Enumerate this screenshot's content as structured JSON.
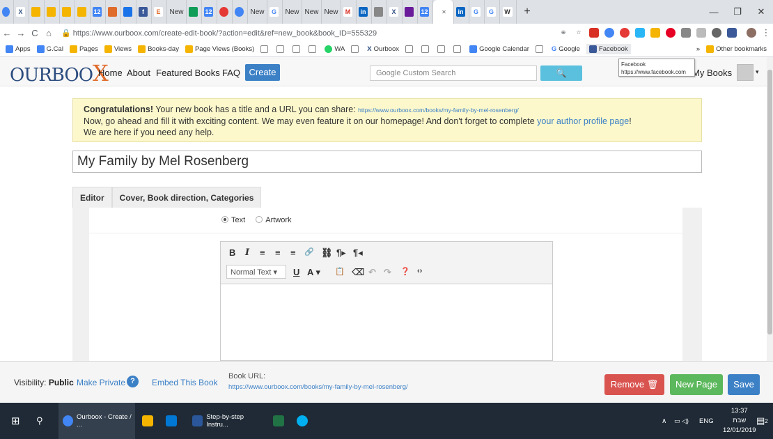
{
  "browser": {
    "tab_labels": [
      "New",
      "New",
      "New",
      "New",
      "New",
      "New"
    ],
    "tab_glyphs": [
      "G",
      "G",
      "W",
      "X",
      "E",
      "M"
    ],
    "new_tab": "+",
    "url": "https://www.ourboox.com/create-edit-book/?action=edit&ref=new_book&book_ID=555329",
    "bookmarks": [
      "Apps",
      "G.Cal",
      "Pages",
      "Views",
      "Books-day",
      "Page Views (Books)",
      "WA",
      "Ourboox",
      "Google Calendar",
      "Google",
      "Facebook"
    ],
    "other_bookmarks": "Other bookmarks",
    "overflow": "»",
    "tooltip_title": "Facebook",
    "tooltip_url": "https://www.facebook.com"
  },
  "site": {
    "logo_left": "OURBOO",
    "logo_x": "X",
    "nav": [
      "Home",
      "About",
      "Featured Books",
      "FAQ"
    ],
    "create": "Create",
    "search_placeholder": "Google Custom Search",
    "search_icon": "🔍",
    "my_books": "My Books",
    "avatar_caret": "▾"
  },
  "congrats": {
    "bold": "Congratulations!",
    "line1": " Your new book has a title and a URL you can share: ",
    "url": "https://www.ourboox.com/books/my-family-by-mel-rosenberg/",
    "line2a": "Now, go ahead and fill it with exciting content. We may even feature it on our homepage! And don't forget to complete ",
    "link": "your author profile page",
    "line2b": "!",
    "line3": "We are here if you need any help."
  },
  "book_title": "My Family by Mel Rosenberg",
  "editor_tabs": [
    "Editor",
    "Cover, Book direction, Categories"
  ],
  "radios": {
    "text": "Text",
    "artwork": "Artwork"
  },
  "toolbar": {
    "row1": [
      "B",
      "I",
      "≡",
      "≡",
      "≡",
      "🔗",
      "⛓",
      "¶▸",
      "¶◂"
    ],
    "format": "Normal Text",
    "format_caret": "▾",
    "row2": [
      "U",
      "A ▾",
      "📋",
      "⌫",
      "↶",
      "↷",
      "❓",
      "‹›"
    ]
  },
  "footer": {
    "visibility_label": "Visibility:",
    "visibility_value": "Public",
    "make_private": "Make Private",
    "help": "?",
    "embed": "Embed This Book",
    "book_url_label": "Book URL:",
    "book_url": "https://www.ourboox.com/books/my-family-by-mel-rosenberg/",
    "remove": "Remove 🗑",
    "new_page": "New Page",
    "save": "Save"
  },
  "taskbar": {
    "chrome": "Ourboox - Create / ...",
    "word": "Step-by-step Instru...",
    "lang": "ENG",
    "time": "13:37",
    "day": "שבת",
    "date": "12/01/2019",
    "notif_count": "2"
  },
  "colors": {
    "accent": "#3c80c6",
    "remove": "#d9534f",
    "newpage": "#5cb85c",
    "banner": "#fcf8cc"
  }
}
